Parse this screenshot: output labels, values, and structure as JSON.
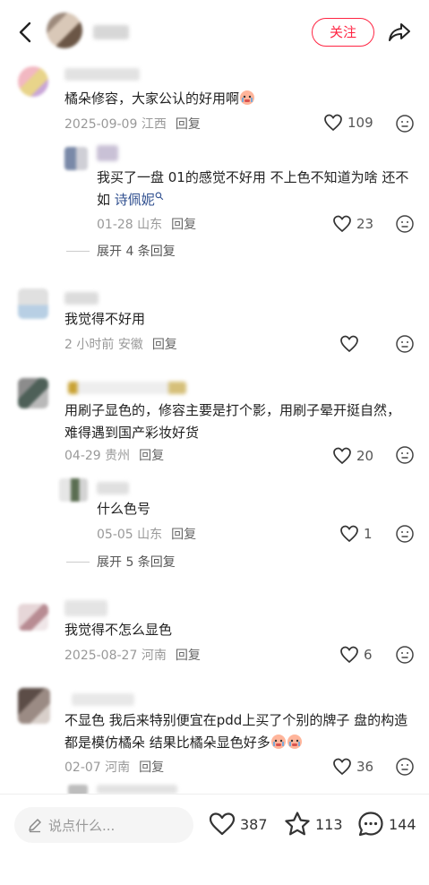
{
  "header": {
    "follow_label": "关注"
  },
  "comments": [
    {
      "text": "橘朵修容，大家公认的好用啊",
      "date": "2025-09-09",
      "location": "江西",
      "reply": "回复",
      "likes": "109"
    },
    {
      "text_pre": "我买了一盘 01的感觉不好用 不上色不知道为啥 还不如 ",
      "mention": "诗佩妮",
      "date": "01-28",
      "location": "山东",
      "reply": "回复",
      "likes": "23"
    },
    {
      "expand": "展开 4 条回复"
    },
    {
      "text": "我觉得不好用",
      "date": "2 小时前",
      "location": "安徽",
      "reply": "回复",
      "likes": ""
    },
    {
      "text": "用刷子显色的，修容主要是打个影，用刷子晕开挺自然，难得遇到国产彩妆好货",
      "date": "04-29",
      "location": "贵州",
      "reply": "回复",
      "likes": "20"
    },
    {
      "text": "什么色号",
      "date": "05-05",
      "location": "山东",
      "reply": "回复",
      "likes": "1"
    },
    {
      "expand": "展开 5 条回复"
    },
    {
      "text": "我觉得不怎么显色",
      "date": "2025-08-27",
      "location": "河南",
      "reply": "回复",
      "likes": "6"
    },
    {
      "text": "不显色 我后来特别便宜在pdd上买了个别的牌子 盘的构造都是模仿橘朵 结果比橘朵显色好多",
      "date": "02-07",
      "location": "河南",
      "reply": "回复",
      "likes": "36"
    }
  ],
  "bottom": {
    "placeholder": "说点什么...",
    "likes": "387",
    "stars": "113",
    "comments": "144"
  },
  "colors": {
    "accent": "#ff2442",
    "mention": "#2f4f8f"
  }
}
